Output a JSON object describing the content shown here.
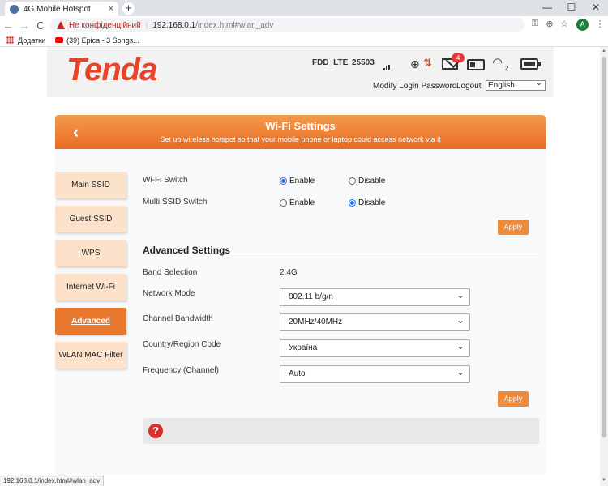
{
  "browser": {
    "tab_title": "4G Mobile Hotspot",
    "tab_close": "×",
    "new_tab": "+",
    "win_min": "—",
    "win_max": "☐",
    "win_close": "✕",
    "back": "←",
    "forward": "→",
    "reload": "C",
    "security_label": "Не конфіденційний",
    "url_host": "192.168.0.1",
    "url_path": "/index.html#wlan_adv",
    "avatar_letter": "A",
    "bookmarks": {
      "apps_label": "Додатки",
      "youtube_label": "(39) Epica - 3 Songs..."
    },
    "status_url": "192.168.0.1/index.html#wlan_adv"
  },
  "header": {
    "logo": "Tenda",
    "network_type": "FDD_LTE",
    "plmn": "25503",
    "message_count": "4",
    "wifi_clients": "2",
    "modify_login": "Modify Login Password",
    "logout": "Logout",
    "language": "English"
  },
  "banner": {
    "back_icon": "‹",
    "title": "Wi-Fi Settings",
    "subtitle": "Set up wireless hotspot so that your mobile phone or laptop could access network via it"
  },
  "sidebar": {
    "items": [
      {
        "label": "Main SSID"
      },
      {
        "label": "Guest SSID"
      },
      {
        "label": "WPS"
      },
      {
        "label": "Internet Wi-Fi"
      },
      {
        "label": "Advanced Settings"
      },
      {
        "label": "WLAN MAC Filter"
      }
    ]
  },
  "switches": {
    "wifi_switch_label": "Wi-Fi Switch",
    "multi_ssid_label": "Multi SSID Switch",
    "enable": "Enable",
    "disable": "Disable",
    "wifi_switch_value": "Enable",
    "multi_ssid_value": "Disable",
    "apply": "Apply"
  },
  "advanced": {
    "title": "Advanced Settings",
    "band_label": "Band Selection",
    "band_value": "2.4G",
    "mode_label": "Network Mode",
    "mode_value": "802.11 b/g/n",
    "bandwidth_label": "Channel Bandwidth",
    "bandwidth_value": "20MHz/40MHz",
    "country_label": "Country/Region Code",
    "country_value": "Україна",
    "freq_label": "Frequency (Channel)",
    "freq_value": "Auto",
    "apply": "Apply"
  },
  "help": {
    "icon": "?"
  }
}
